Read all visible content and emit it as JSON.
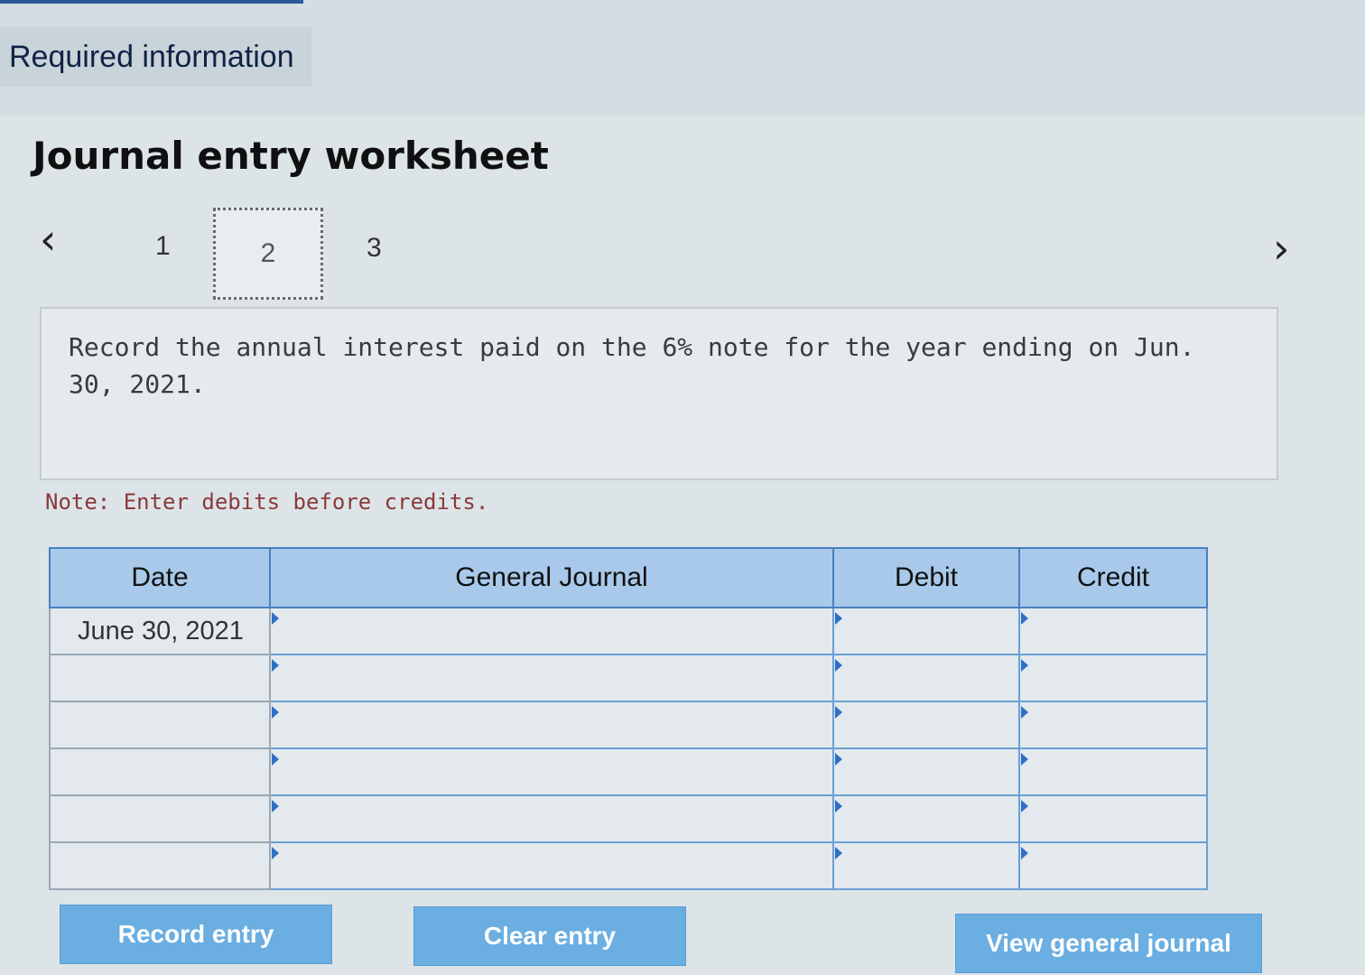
{
  "tab": {
    "label": "Required information"
  },
  "worksheet": {
    "title": "Journal entry worksheet",
    "steps": [
      "1",
      "2",
      "3"
    ],
    "current_step": "2",
    "instruction": "Record the annual interest paid on the 6% note for the year ending on Jun. 30, 2021.",
    "note": "Note: Enter debits before credits."
  },
  "table": {
    "headers": {
      "date": "Date",
      "journal": "General Journal",
      "debit": "Debit",
      "credit": "Credit"
    },
    "rows": [
      {
        "date": "June 30, 2021",
        "account": "",
        "debit": "",
        "credit": ""
      },
      {
        "date": "",
        "account": "",
        "debit": "",
        "credit": ""
      },
      {
        "date": "",
        "account": "",
        "debit": "",
        "credit": ""
      },
      {
        "date": "",
        "account": "",
        "debit": "",
        "credit": ""
      },
      {
        "date": "",
        "account": "",
        "debit": "",
        "credit": ""
      },
      {
        "date": "",
        "account": "",
        "debit": "",
        "credit": ""
      }
    ]
  },
  "buttons": {
    "record": "Record entry",
    "clear": "Clear entry",
    "view": "View general journal"
  },
  "icons": {
    "prev": "chevron-left-icon",
    "next": "chevron-right-icon"
  },
  "colors": {
    "header_bg": "#a8c9ea",
    "button_bg": "#6aaee2",
    "note_text": "#8a3a3a"
  }
}
